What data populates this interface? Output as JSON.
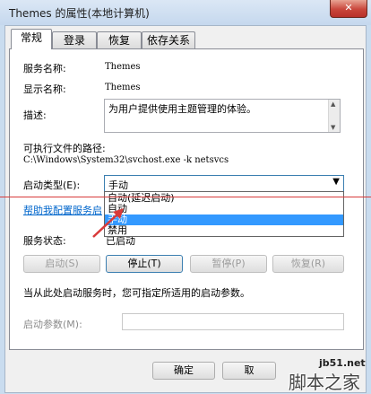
{
  "window": {
    "title": "Themes 的属性(本地计算机)",
    "close_glyph": "✕"
  },
  "tabs": [
    {
      "label": "常规"
    },
    {
      "label": "登录"
    },
    {
      "label": "恢复"
    },
    {
      "label": "依存关系"
    }
  ],
  "general": {
    "service_name_label": "服务名称:",
    "service_name_value": "Themes",
    "display_name_label": "显示名称:",
    "display_name_value": "Themes",
    "description_label": "描述:",
    "description_value": "为用户提供使用主题管理的体验。",
    "exe_path_label": "可执行文件的路径:",
    "exe_path_value": "C:\\Windows\\System32\\svchost.exe -k netsvcs",
    "startup_type_label": "启动类型(E):",
    "startup_type_value": "手动",
    "startup_options": [
      "自动(延迟启动)",
      "自动",
      "手动",
      "禁用"
    ],
    "startup_selected_index": 2,
    "help_link": "帮助我配置服务启",
    "status_label": "服务状态:",
    "status_value": "已启动",
    "start_button": "启动(S)",
    "stop_button": "停止(T)",
    "pause_button": "暂停(P)",
    "resume_button": "恢复(R)",
    "hint_text": "当从此处启动服务时，您可指定所适用的启动参数。",
    "param_label": "启动参数(M):",
    "param_value": ""
  },
  "footer": {
    "ok_button": "确定",
    "cancel_button": "取"
  },
  "watermark": {
    "site": "jb51.net",
    "brand": "脚本之家"
  },
  "colors": {
    "selection": "#3399ff",
    "annotation": "#d83a3a",
    "close": "#c9463b"
  }
}
